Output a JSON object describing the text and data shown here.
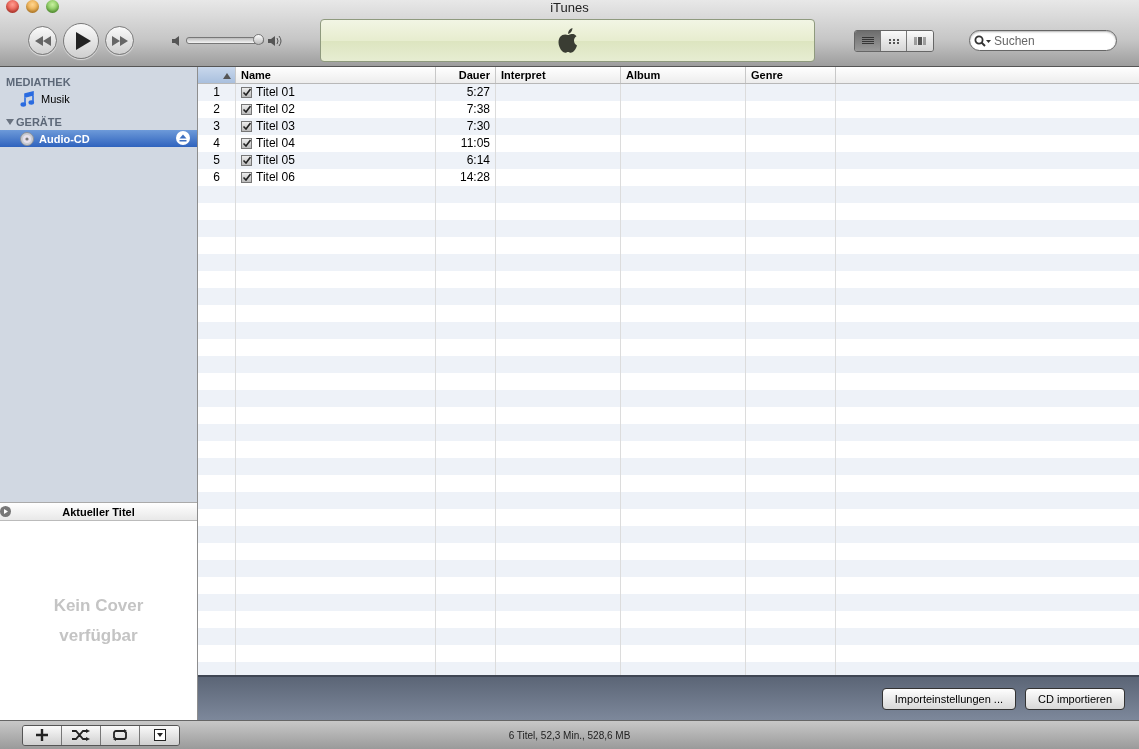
{
  "window": {
    "title": "iTunes"
  },
  "toolbar": {
    "volume": {
      "level": 0.95
    },
    "view_buttons": [
      {
        "kind": "list",
        "selected": true
      },
      {
        "kind": "grid",
        "selected": false
      },
      {
        "kind": "coverflow",
        "selected": false
      }
    ],
    "search": {
      "placeholder": "Suchen"
    }
  },
  "sidebar": {
    "sections": [
      {
        "title": "MEDIATHEK",
        "items": [
          {
            "label": "Musik",
            "kind": "music",
            "selected": false,
            "ejectable": false
          }
        ]
      },
      {
        "title": "GERÄTE",
        "expanded": true,
        "items": [
          {
            "label": "Audio-CD",
            "kind": "cd",
            "selected": true,
            "ejectable": true
          }
        ]
      }
    ]
  },
  "now_playing": {
    "title": "Aktueller Titel",
    "artwork_message": "Kein Cover verfügbar"
  },
  "table": {
    "index_column": {
      "sorted": true
    },
    "columns": [
      {
        "label": "Name"
      },
      {
        "label": "Dauer"
      },
      {
        "label": "Interpret"
      },
      {
        "label": "Album"
      },
      {
        "label": "Genre"
      }
    ],
    "rows": [
      {
        "number": "1",
        "checked": true,
        "name": "Titel 01",
        "duration": "5:27"
      },
      {
        "number": "2",
        "checked": true,
        "name": "Titel 02",
        "duration": "7:38"
      },
      {
        "number": "3",
        "checked": true,
        "name": "Titel 03",
        "duration": "7:30"
      },
      {
        "number": "4",
        "checked": true,
        "name": "Titel 04",
        "duration": "11:05"
      },
      {
        "number": "5",
        "checked": true,
        "name": "Titel 05",
        "duration": "6:14"
      },
      {
        "number": "6",
        "checked": true,
        "name": "Titel 06",
        "duration": "14:28"
      }
    ]
  },
  "action_buttons": [
    "Importeinstellungen ...",
    "CD importieren"
  ],
  "status_bar": "6 Titel, 52,3 Min., 528,6 MB"
}
